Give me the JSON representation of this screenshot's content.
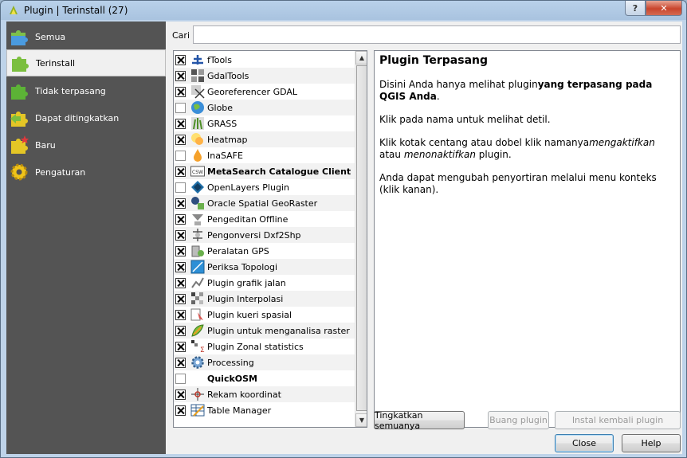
{
  "window": {
    "title": "Plugin | Terinstall (27)",
    "help_label": "?",
    "close_label": "✕"
  },
  "sidebar": {
    "items": [
      {
        "label": "Semua",
        "icon": "puzzle-all-icon",
        "active": false
      },
      {
        "label": "Terinstall",
        "icon": "puzzle-installed-icon",
        "active": true
      },
      {
        "label": "Tidak terpasang",
        "icon": "puzzle-not-installed-icon",
        "active": false
      },
      {
        "label": "Dapat ditingkatkan",
        "icon": "puzzle-upgradeable-icon",
        "active": false
      },
      {
        "label": "Baru",
        "icon": "puzzle-new-icon",
        "active": false
      },
      {
        "label": "Pengaturan",
        "icon": "gear-settings-icon",
        "active": false
      }
    ]
  },
  "search": {
    "label": "Cari",
    "value": "",
    "placeholder": ""
  },
  "plugins": [
    {
      "label": "fTools",
      "checked": true,
      "bold": false,
      "icon": "ftools-icon"
    },
    {
      "label": "GdalTools",
      "checked": true,
      "bold": false,
      "icon": "gdaltools-icon"
    },
    {
      "label": "Georeferencer GDAL",
      "checked": true,
      "bold": false,
      "icon": "georeferencer-icon"
    },
    {
      "label": "Globe",
      "checked": false,
      "bold": false,
      "icon": "globe-icon"
    },
    {
      "label": "GRASS",
      "checked": true,
      "bold": false,
      "icon": "grass-icon"
    },
    {
      "label": "Heatmap",
      "checked": true,
      "bold": false,
      "icon": "heatmap-icon"
    },
    {
      "label": "InaSAFE",
      "checked": false,
      "bold": false,
      "icon": "inasafe-icon"
    },
    {
      "label": "MetaSearch Catalogue Client",
      "checked": true,
      "bold": true,
      "icon": "csw-icon"
    },
    {
      "label": "OpenLayers Plugin",
      "checked": false,
      "bold": false,
      "icon": "openlayers-icon"
    },
    {
      "label": "Oracle Spatial GeoRaster",
      "checked": true,
      "bold": false,
      "icon": "oracle-georaster-icon"
    },
    {
      "label": "Pengeditan Offline",
      "checked": true,
      "bold": false,
      "icon": "offline-editing-icon"
    },
    {
      "label": "Pengonversi Dxf2Shp",
      "checked": true,
      "bold": false,
      "icon": "dxf2shp-icon"
    },
    {
      "label": "Peralatan GPS",
      "checked": true,
      "bold": false,
      "icon": "gps-tools-icon"
    },
    {
      "label": "Periksa Topologi",
      "checked": true,
      "bold": false,
      "icon": "topology-checker-icon"
    },
    {
      "label": "Plugin grafik jalan",
      "checked": true,
      "bold": false,
      "icon": "road-graph-icon"
    },
    {
      "label": "Plugin Interpolasi",
      "checked": true,
      "bold": false,
      "icon": "interpolation-icon"
    },
    {
      "label": "Plugin kueri spasial",
      "checked": true,
      "bold": false,
      "icon": "spatial-query-icon"
    },
    {
      "label": "Plugin untuk menganalisa raster",
      "checked": true,
      "bold": false,
      "icon": "raster-terrain-icon"
    },
    {
      "label": "Plugin Zonal statistics",
      "checked": true,
      "bold": false,
      "icon": "zonal-statistics-icon"
    },
    {
      "label": "Processing",
      "checked": true,
      "bold": false,
      "icon": "processing-gear-icon"
    },
    {
      "label": "QuickOSM",
      "checked": false,
      "bold": true,
      "icon": "quickosm-icon"
    },
    {
      "label": "Rekam koordinat",
      "checked": true,
      "bold": false,
      "icon": "coordinate-capture-icon"
    },
    {
      "label": "Table Manager",
      "checked": true,
      "bold": false,
      "icon": "table-manager-icon"
    }
  ],
  "info": {
    "heading": "Plugin Terpasang",
    "p1_pre": "Disini Anda hanya melihat plugin",
    "p1_bold": "yang terpasang pada QGIS Anda",
    "p1_post": ".",
    "p2": "Klik pada nama untuk melihat detil.",
    "p3_pre": "Klik kotak centang atau dobel klik namanya",
    "p3_em1": "mengaktifkan",
    "p3_mid": " atau ",
    "p3_em2": "menonaktifkan",
    "p3_post": " plugin.",
    "p4": "Anda dapat mengubah penyortiran melalui menu konteks (klik kanan)."
  },
  "buttons": {
    "upgrade_all": "Tingkatkan semuanya",
    "uninstall": "Buang plugin",
    "reinstall": "Instal kembali plugin",
    "close": "Close",
    "help": "Help"
  },
  "colors": {
    "sidebar_bg": "#545454",
    "close_red": "#c9452c"
  }
}
